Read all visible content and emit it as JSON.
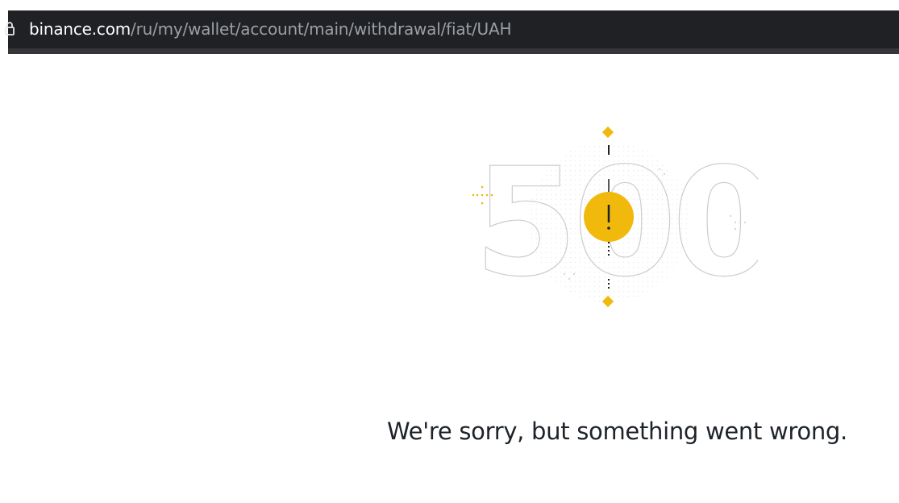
{
  "browser": {
    "url_domain": "binance.com",
    "url_path": "/ru/my/wallet/account/main/withdrawal/fiat/UAH"
  },
  "error": {
    "code": "500",
    "message": "We're sorry, but something went wrong."
  },
  "colors": {
    "accent": "#f0b90b",
    "text": "#1e2329",
    "address_bar_bg": "#202124"
  }
}
